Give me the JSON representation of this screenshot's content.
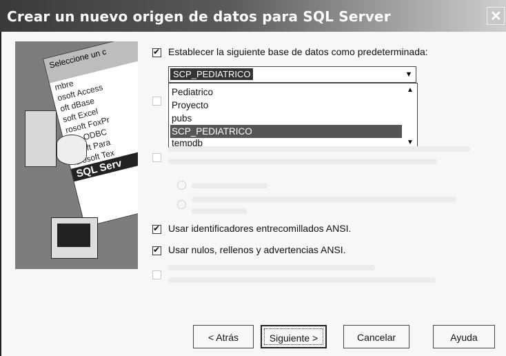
{
  "window": {
    "title": "Crear un nuevo origen de datos para SQL Server",
    "close_glyph": "✕"
  },
  "illustration": {
    "header": "Seleccione un c",
    "rows": [
      "mbre",
      "osoft Access",
      "oft dBase",
      "soft Excel",
      "rosoft FoxPr",
      "soft ODBC",
      "rosoft Para",
      "icrosoft Tex",
      "SQL Serv"
    ],
    "selected_row": "SQL Serv"
  },
  "options": {
    "set_default_db": {
      "label": "Establecer la siguiente base de datos como predeterminada:",
      "checked": true
    },
    "database_combo": {
      "value": "SCP_PEDIATRICO"
    },
    "database_list": {
      "items": [
        "Pediatrico",
        "Proyecto",
        "pubs",
        "SCP_PEDIATRICO",
        "tempdb"
      ],
      "selected_index": 3
    },
    "ansi_quoted": {
      "label": "Usar identificadores entrecomillados ANSI.",
      "checked": true
    },
    "ansi_nulls": {
      "label": "Usar nulos, rellenos y advertencias ANSI.",
      "checked": true
    }
  },
  "buttons": {
    "back": "< Atrás",
    "next": "Siguiente >",
    "cancel": "Cancelar",
    "help": "Ayuda"
  }
}
